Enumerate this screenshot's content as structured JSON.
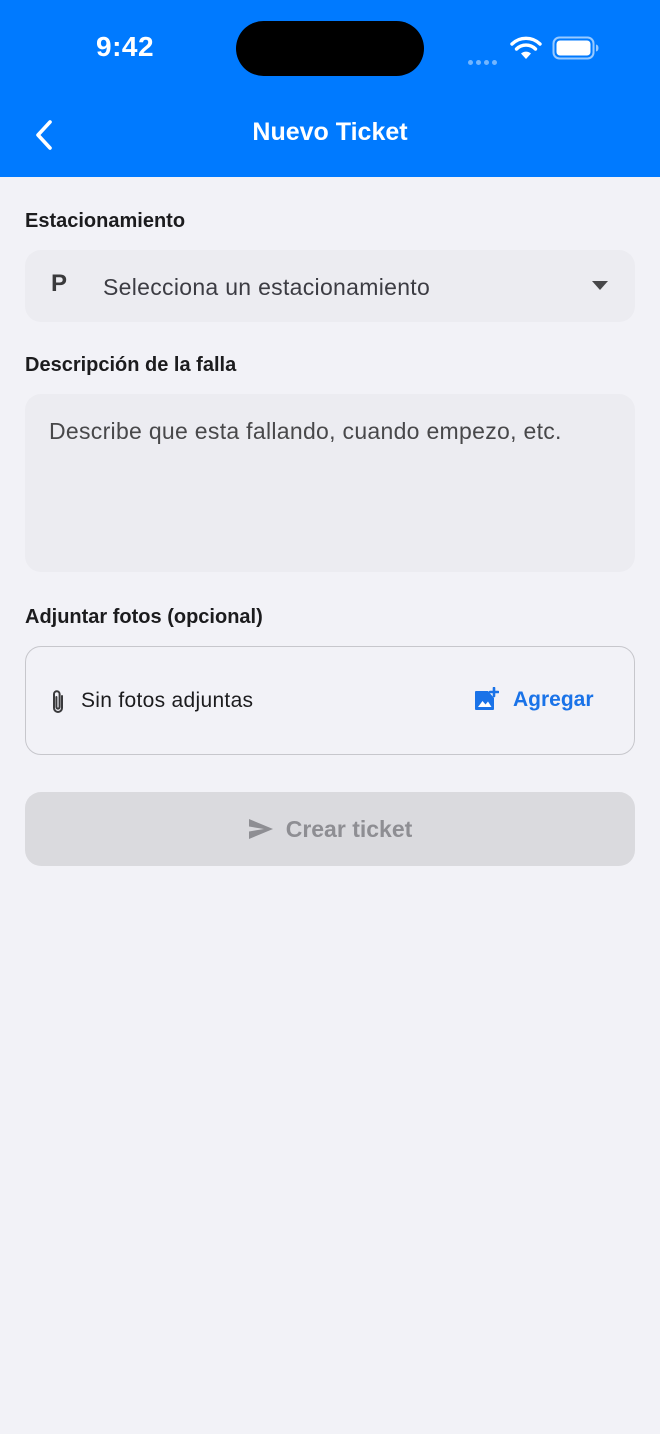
{
  "status_bar": {
    "time": "9:42",
    "icons": [
      "signal-dots-icon",
      "wifi-icon",
      "battery-icon"
    ]
  },
  "nav": {
    "title": "Nuevo Ticket",
    "back_icon": "chevron-left-icon"
  },
  "form": {
    "parking": {
      "label": "Estacionamiento",
      "icon": "parking-icon",
      "icon_glyph": "P",
      "placeholder": "Selecciona un estacionamiento"
    },
    "description": {
      "label": "Descripción de la falla",
      "placeholder": "Describe que esta fallando, cuando empezo, etc."
    },
    "photos": {
      "label": "Adjuntar fotos (opcional)",
      "status": "Sin fotos adjuntas",
      "add_label": "Agregar"
    },
    "submit_label": "Crear ticket"
  },
  "colors": {
    "accent": "#007aff",
    "link": "#1a73e8",
    "background": "#f2f2f7",
    "field": "#ececf1",
    "disabled_button": "#dadade"
  }
}
